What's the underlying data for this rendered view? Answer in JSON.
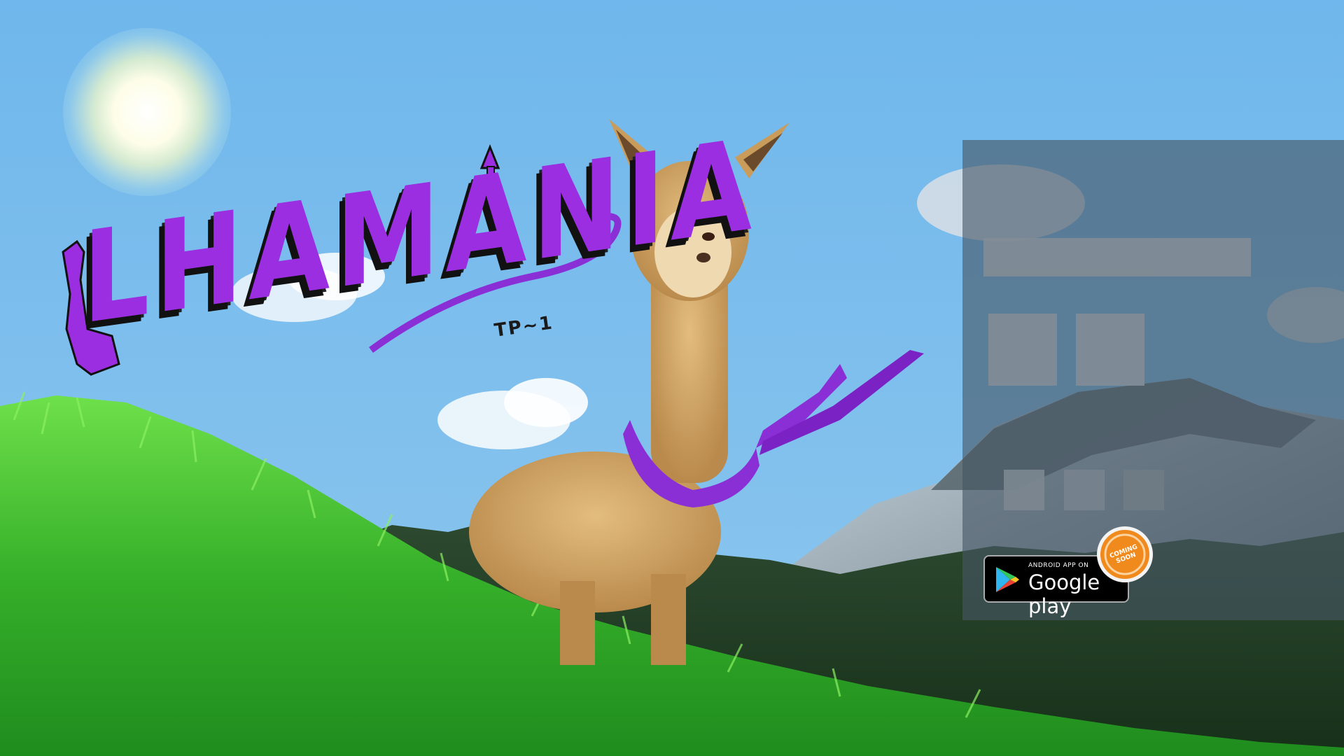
{
  "game": {
    "title": "LHAMANIA",
    "subtitle": "TP~1"
  },
  "store": {
    "small_label": "ANDROID APP ON",
    "big_label": "Google play",
    "ribbon": "COMING SOON"
  },
  "icons": {
    "store_logo": "google-play-triangle-icon"
  },
  "colors": {
    "sky": "#6db6ea",
    "title_purple": "#9b2ee0",
    "grass": "#3fbf2a",
    "ribbon_orange": "#f08a1c"
  }
}
